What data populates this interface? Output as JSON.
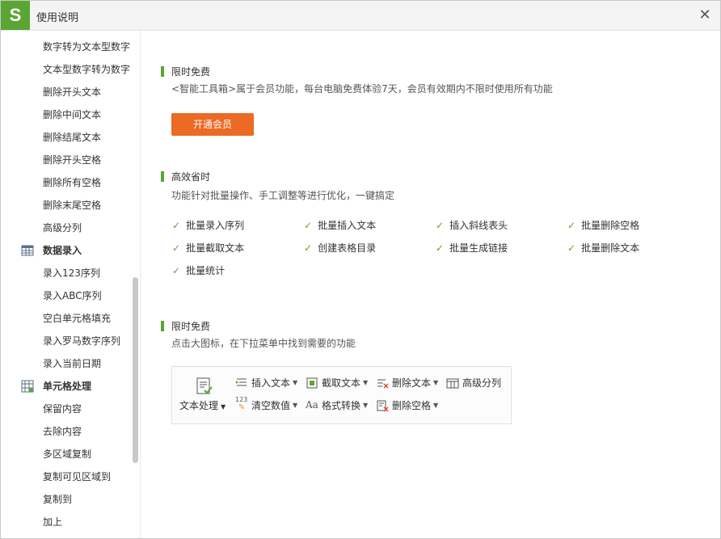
{
  "window": {
    "title": "使用说明",
    "logo": "S"
  },
  "sidebar": {
    "items_top": [
      "数字转为文本型数字",
      "文本型数字转为数字",
      "删除开头文本",
      "删除中间文本",
      "删除结尾文本",
      "删除开头空格",
      "删除所有空格",
      "删除末尾空格",
      "高级分列"
    ],
    "group1": {
      "label": "数据录入",
      "icon": "calendar-grid-icon",
      "items": [
        "录入123序列",
        "录入ABC序列",
        "空白单元格填充",
        "录入罗马数字序列",
        "录入当前日期"
      ]
    },
    "group2": {
      "label": "单元格处理",
      "icon": "cell-grid-icon",
      "items": [
        "保留内容",
        "去除内容",
        "多区域复制",
        "复制可见区域到",
        "复制到",
        "加上"
      ]
    }
  },
  "main": {
    "section1": {
      "title": "限时免费",
      "desc": "<智能工具箱>属于会员功能，每台电脑免费体验7天，会员有效期内不限时使用所有功能",
      "button": "开通会员"
    },
    "section2": {
      "title": "高效省时",
      "desc": "功能针对批量操作、手工调整等进行优化，一键搞定",
      "features": [
        "批量录入序列",
        "批量插入文本",
        "插入斜线表头",
        "批量删除空格",
        "批量截取文本",
        "创建表格目录",
        "批量生成链接",
        "批量删除文本",
        "批量统计"
      ]
    },
    "section3": {
      "title": "限时免费",
      "desc": "点击大图标，在下拉菜单中找到需要的功能",
      "ribbon": {
        "big": "文本处理",
        "insert": "插入文本",
        "extract": "截取文本",
        "delete_text": "删除文本",
        "split": "高级分列",
        "clear": "清空数值",
        "format": "格式转换",
        "delete_space": "删除空格",
        "num_glyph": "123",
        "fmt_glyph": "Aa"
      }
    }
  },
  "colors": {
    "accent": "#5aa634",
    "button": "#eb6a24"
  }
}
